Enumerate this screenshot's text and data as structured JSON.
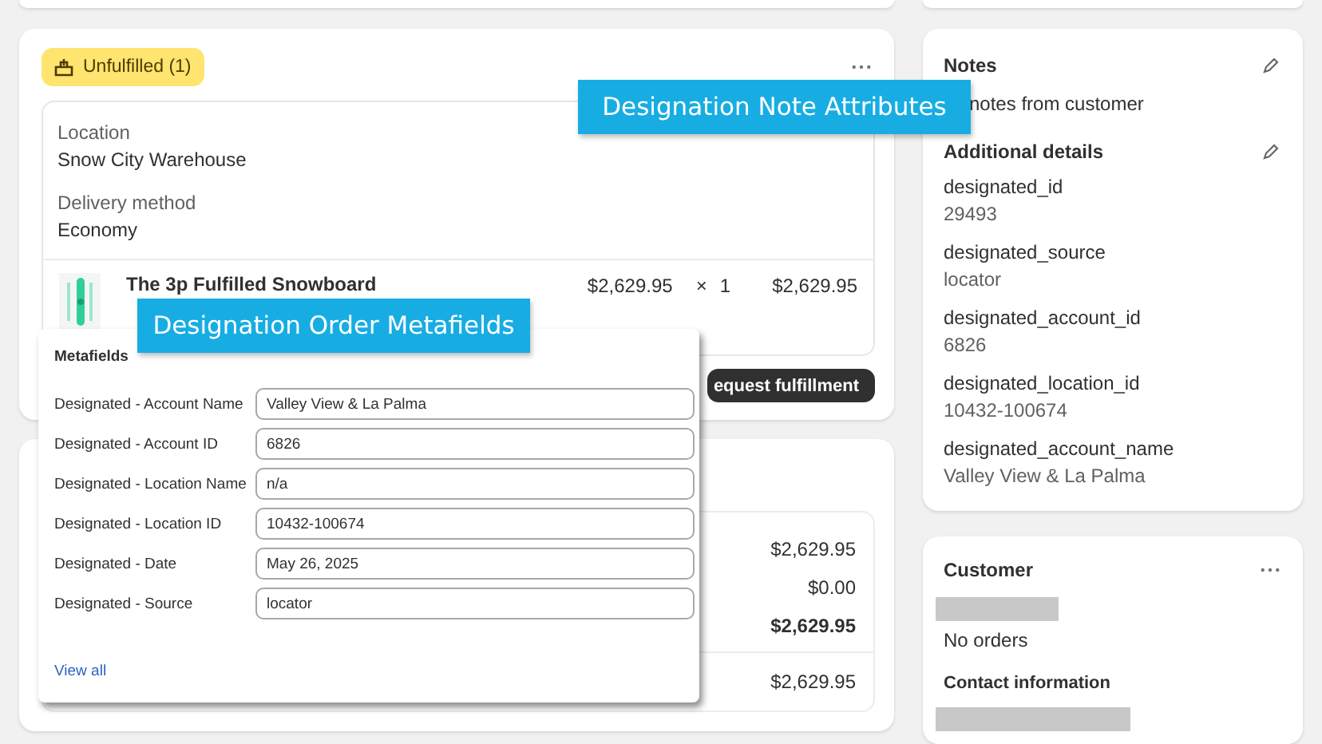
{
  "fulfillment": {
    "badge": "Unfulfilled (1)",
    "location_label": "Location",
    "location": "Snow City Warehouse",
    "delivery_label": "Delivery method",
    "delivery": "Economy",
    "item": {
      "title": "The 3p Fulfilled Snowboard",
      "price": "$2,629.95",
      "times": "×",
      "quantity": "1",
      "total": "$2,629.95"
    },
    "button": "equest fulfillment"
  },
  "summary": {
    "rows": [
      {
        "value": "$2,629.95",
        "emphasis": false
      },
      {
        "value": "$0.00",
        "emphasis": false
      },
      {
        "value": "$2,629.95",
        "emphasis": true
      }
    ],
    "paid": "$2,629.95"
  },
  "metafields": {
    "title": "Metafields",
    "fields": [
      {
        "label": "Designated - Account Name",
        "value": "Valley View & La Palma"
      },
      {
        "label": "Designated - Account ID",
        "value": "6826"
      },
      {
        "label": "Designated - Location Name",
        "value": "n/a"
      },
      {
        "label": "Designated - Location ID",
        "value": "10432-100674"
      },
      {
        "label": "Designated - Date",
        "value": "May 26, 2025"
      },
      {
        "label": "Designated - Source",
        "value": "locator"
      }
    ],
    "link": "View all"
  },
  "notes": {
    "title": "Notes",
    "text": "notes from customer",
    "details_title": "Additional details",
    "details": [
      {
        "key": "designated_id",
        "value": "29493"
      },
      {
        "key": "designated_source",
        "value": "locator"
      },
      {
        "key": "designated_account_id",
        "value": "6826"
      },
      {
        "key": "designated_location_id",
        "value": "10432-100674"
      },
      {
        "key": "designated_account_name",
        "value": "Valley View & La Palma"
      }
    ]
  },
  "customer": {
    "title": "Customer",
    "orders": "No orders",
    "contact_title": "Contact information"
  },
  "callouts": [
    {
      "text": "Designation Note Attributes"
    },
    {
      "text": "Designation Order Metafields"
    }
  ]
}
